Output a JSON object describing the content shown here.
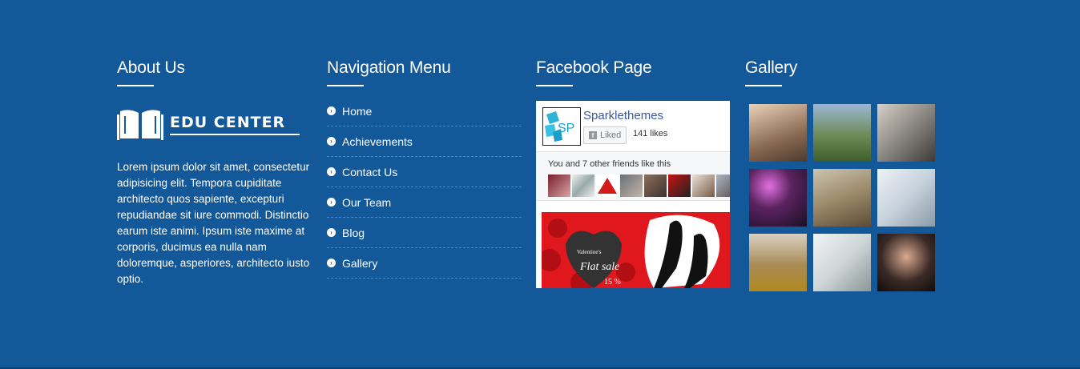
{
  "about": {
    "title": "About Us",
    "logo_text": "EDU CENTER",
    "text": "Lorem ipsum dolor sit amet, consectetur adipisicing elit. Tempora cupiditate architecto quos sapiente, excepturi repudiandae sit iure commodi. Distinctio earum iste animi.  Ipsum iste maxime at corporis, ducimus ea nulla nam doloremque, asperiores, architecto iusto optio."
  },
  "nav": {
    "title": "Navigation Menu",
    "items": [
      {
        "label": "Home"
      },
      {
        "label": "Achievements"
      },
      {
        "label": "Contact Us"
      },
      {
        "label": "Our Team"
      },
      {
        "label": "Blog"
      },
      {
        "label": "Gallery"
      }
    ]
  },
  "facebook": {
    "title": "Facebook Page",
    "page_name": "Sparklethemes",
    "avatar_text": "SP",
    "like_label": "Liked",
    "likes": "141 likes",
    "friends_text": "You and 7 other friends like this",
    "banner_small": "Valentine's",
    "banner_big": "Flat sale",
    "banner_pct": "15 %"
  },
  "gallery": {
    "title": "Gallery",
    "images": [
      {
        "name": "friends-group-photo",
        "color": "#b59a82"
      },
      {
        "name": "mountain-landscape-photo",
        "color": "#6d8b55"
      },
      {
        "name": "woman-reading-photo",
        "color": "#8a8680"
      },
      {
        "name": "concert-lights-photo",
        "color": "#5b2360"
      },
      {
        "name": "guitar-outdoors-photo",
        "color": "#9c8a6a"
      },
      {
        "name": "laptop-work-photo",
        "color": "#c7d2dc"
      },
      {
        "name": "fashion-show-photo",
        "color": "#a88b55"
      },
      {
        "name": "desk-papers-photo",
        "color": "#cfd6d8"
      },
      {
        "name": "woman-portrait-photo",
        "color": "#3a2a26"
      }
    ]
  },
  "colors": {
    "background": "#135899",
    "facebook_blue": "#3b5998",
    "banner_red": "#e0171d"
  }
}
